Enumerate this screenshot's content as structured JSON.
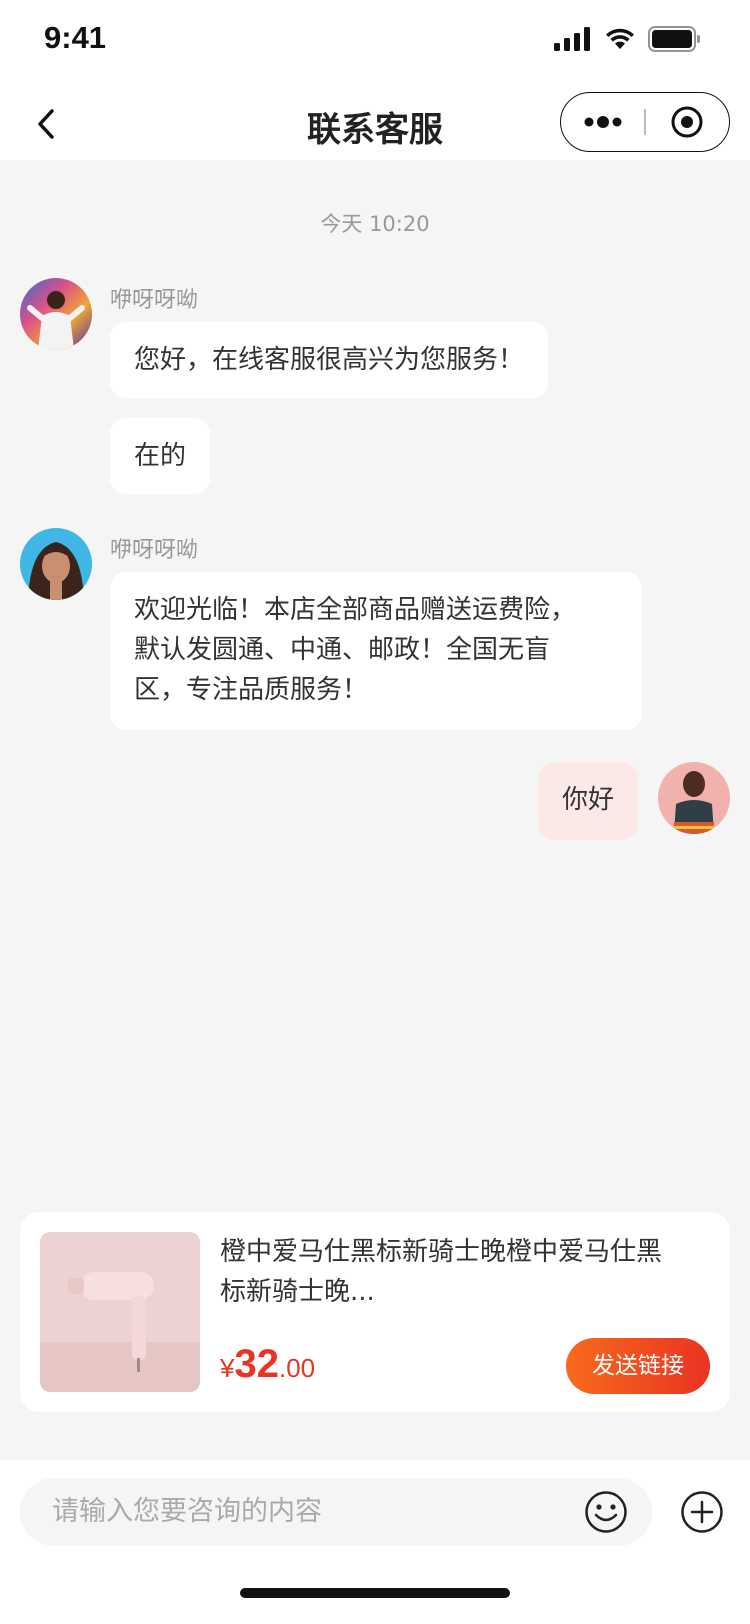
{
  "status_bar": {
    "time": "9:41"
  },
  "nav": {
    "title": "联系客服"
  },
  "chat": {
    "timestamp": "今天 10:20",
    "messages": [
      {
        "sender": "咿呀呀呦",
        "text": "您好，在线客服很高兴为您服务！"
      },
      {
        "sender": "",
        "text": "在的"
      },
      {
        "sender": "咿呀呀呦",
        "text_lines": [
          "欢迎光临！本店全部商品赠送运费险，",
          "默认发圆通、中通、邮政！全国无盲",
          "区，专注品质服务！"
        ]
      },
      {
        "sender": "me",
        "text": "你好"
      }
    ]
  },
  "product": {
    "title_lines": [
      "橙中爱马仕黑标新骑士晚橙中爱马仕黑",
      "标新骑士晚..."
    ],
    "price_symbol": "¥",
    "price_int": "32",
    "price_dec": ".00",
    "send_button": "发送链接"
  },
  "input": {
    "placeholder": "请输入您要咨询的内容"
  },
  "colors": {
    "accent": "#e93323",
    "accent_gradient_start": "#f76b1c",
    "my_bubble": "#fbe9e7"
  }
}
